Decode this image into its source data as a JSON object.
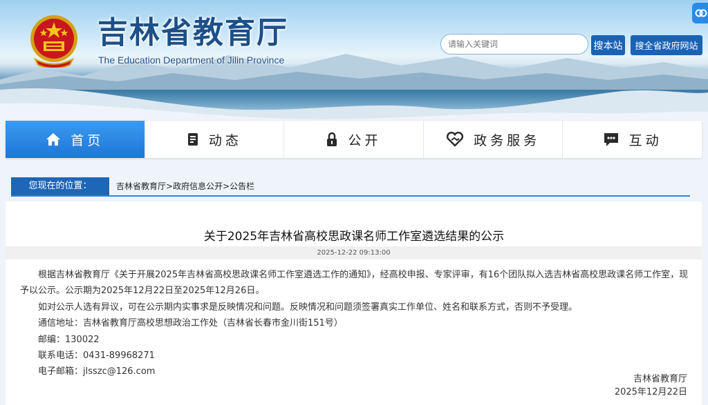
{
  "header": {
    "title": "吉林省教育厅",
    "subtitle": "The Education Department of Jilin Province",
    "search_placeholder": "请输入关键词",
    "search_site_label": "搜本站",
    "search_gov_label": "搜全省政府网站"
  },
  "nav": {
    "items": [
      {
        "label": "首页",
        "icon": "home-icon"
      },
      {
        "label": "动态",
        "icon": "news-icon"
      },
      {
        "label": "公开",
        "icon": "lock-icon"
      },
      {
        "label": "政务服务",
        "icon": "service-heart-icon"
      },
      {
        "label": "互动",
        "icon": "chat-icon"
      }
    ],
    "active_index": 0
  },
  "breadcrumb": {
    "label": "您现在的位置：",
    "items": [
      "吉林省教育厅",
      "政府信息公开",
      "公告栏"
    ],
    "separator": ">"
  },
  "article": {
    "title": "关于2025年吉林省高校思政课名师工作室遴选结果的公示",
    "date": "2025-12-22 09:13:00",
    "paragraphs": [
      "根据吉林省教育厅《关于开展2025年吉林省高校思政课名师工作室遴选工作的通知》，经高校申报、专家评审，有16个团队拟入选吉林省高校思政课名师工作室，现予以公示。公示期为2025年12月22日至2025年12月26日。",
      "如对公示人选有异议，可在公示期内实事求是反映情况和问题。反映情况和问题须签署真实工作单位、姓名和联系方式，否则不予受理。"
    ],
    "contact_lines": [
      "通信地址：吉林省教育厅高校思想政治工作处（吉林省长春市金川街151号）",
      "邮编：130022",
      "联系电话：0431-89968271",
      "电子邮箱：jlsszc@126.com"
    ],
    "signature_org": "吉林省教育厅",
    "signature_date": "2025年12月22日"
  },
  "colors": {
    "brand_blue": "#1e66b8",
    "nav_active": "#2a8ae4",
    "title_blue": "#1d4f88"
  }
}
